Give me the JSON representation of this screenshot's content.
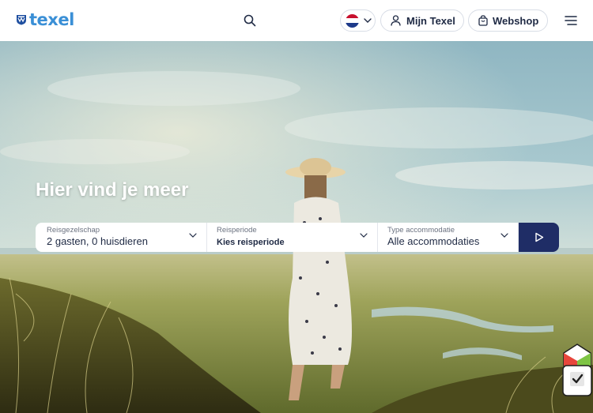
{
  "header": {
    "logo_text": "texel",
    "account_label": "Mijn Texel",
    "shop_label": "Webshop"
  },
  "hero": {
    "title": "Hier vind je meer"
  },
  "search": {
    "party_label": "Reisgezelschap",
    "party_value": "2 gasten, 0 huisdieren",
    "period_label": "Reisperiode",
    "period_value": "Kies reisperiode",
    "accommodation_label": "Type accommodatie",
    "accommodation_value": "Alle accommodaties"
  },
  "icons": {
    "search": "search-icon",
    "flag": "flag-nl-icon",
    "user": "user-icon",
    "bag": "shopping-bag-icon",
    "menu": "hamburger-menu-icon",
    "submit": "play-arrow-icon",
    "widget": "checkmark-box-icon"
  },
  "colors": {
    "brand_blue": "#3a8fd6",
    "navy": "#1f2d66",
    "text_dark": "#1f2a44"
  }
}
